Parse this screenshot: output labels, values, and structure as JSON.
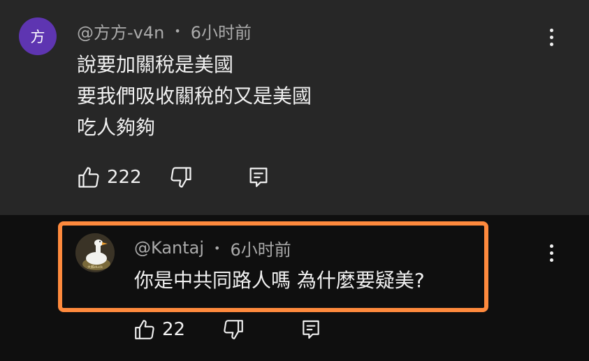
{
  "top_comment": {
    "avatar_letter": "方",
    "author": "@方方-v4n",
    "separator": "•",
    "time": "6小时前",
    "lines": [
      "說要加關稅是美國",
      "要我們吸收關稅的又是美國",
      "吃人夠夠"
    ],
    "likes": "222",
    "icons": {
      "like": "thumb-up-icon",
      "dislike": "thumb-down-icon",
      "reply": "reply-icon",
      "more": "more-vert-icon"
    }
  },
  "reply": {
    "author": "@Kantaj",
    "separator": "•",
    "time": "6小时前",
    "text": "你是中共同路人嗎 為什麼要疑美?",
    "likes": "22",
    "avatar_caption": "大鵝duck"
  },
  "colors": {
    "top_background": "#272727",
    "page_background": "#0f0f0f",
    "highlight_border": "#ff8a3d",
    "avatar_purple": "#5e35b1",
    "meta_text": "#aaaaaa",
    "body_text": "#f1f1f1"
  }
}
